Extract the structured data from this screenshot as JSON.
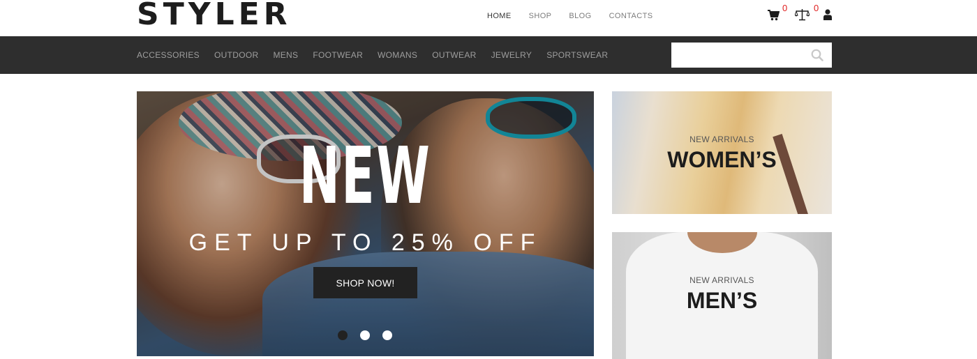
{
  "header": {
    "logo": "STYLER",
    "nav": [
      {
        "label": "HOME",
        "active": true
      },
      {
        "label": "SHOP",
        "active": false
      },
      {
        "label": "BLOG",
        "active": false
      },
      {
        "label": "CONTACTS",
        "active": false
      }
    ],
    "cart_count": "0",
    "compare_count": "0",
    "icons": [
      "cart-icon",
      "compare-icon",
      "user-icon"
    ]
  },
  "categories": [
    "ACCESSORIES",
    "OUTDOOR",
    "MENS",
    "FOOTWEAR",
    "WOMANS",
    "OUTWEAR",
    "JEWELRY",
    "SPORTSWEAR"
  ],
  "search": {
    "placeholder": "",
    "value": ""
  },
  "hero": {
    "title": "NEW",
    "subtitle": "GET UP TO 25% OFF",
    "button": "SHOP NOW!",
    "slides": 3,
    "active_slide": 1
  },
  "promos": {
    "women": {
      "small": "NEW ARRIVALS",
      "big": "WOMEN’S"
    },
    "men": {
      "small": "NEW ARRIVALS",
      "big": "MEN’S"
    }
  },
  "colors": {
    "category_bar": "#2e2e2e",
    "badge": "#e02020",
    "button": "#222222"
  }
}
